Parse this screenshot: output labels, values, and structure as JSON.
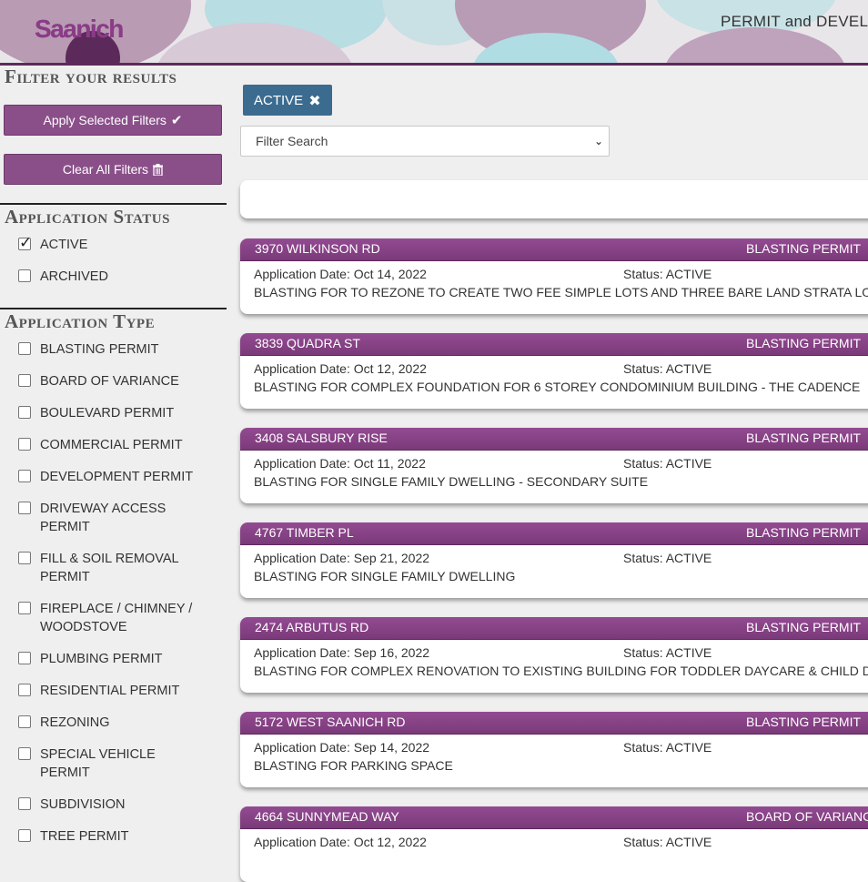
{
  "header": {
    "logo_text": "Saanich",
    "title": "PERMIT and DEVEL"
  },
  "sidebar": {
    "filter_title": "Filter your results",
    "apply_button": "Apply Selected Filters",
    "clear_button": "Clear All Filters",
    "status_heading": "Application Status",
    "status_options": [
      {
        "label": "ACTIVE",
        "checked": true
      },
      {
        "label": "ARCHIVED",
        "checked": false
      }
    ],
    "type_heading": "Application Type",
    "type_options": [
      {
        "label": "BLASTING PERMIT"
      },
      {
        "label": "BOARD OF VARIANCE"
      },
      {
        "label": "BOULEVARD PERMIT"
      },
      {
        "label": "COMMERCIAL PERMIT"
      },
      {
        "label": "DEVELOPMENT PERMIT"
      },
      {
        "label": "DRIVEWAY ACCESS\nPERMIT"
      },
      {
        "label": "FILL & SOIL REMOVAL\nPERMIT"
      },
      {
        "label": "FIREPLACE / CHIMNEY /\nWOODSTOVE"
      },
      {
        "label": "PLUMBING PERMIT"
      },
      {
        "label": "RESIDENTIAL PERMIT"
      },
      {
        "label": "REZONING"
      },
      {
        "label": "SPECIAL VEHICLE\nPERMIT"
      },
      {
        "label": "SUBDIVISION"
      },
      {
        "label": "TREE PERMIT"
      }
    ]
  },
  "main": {
    "active_chip": "ACTIVE",
    "filter_search_placeholder": "Filter Search",
    "results": [
      {
        "address": "3970 WILKINSON RD",
        "type": "BLASTING PERMIT",
        "date": "Application Date: Oct 14, 2022",
        "status": "Status: ACTIVE",
        "description": "BLASTING FOR TO REZONE TO CREATE TWO FEE SIMPLE LOTS AND THREE BARE LAND STRATA LO"
      },
      {
        "address": "3839 QUADRA ST",
        "type": "BLASTING PERMIT",
        "date": "Application Date: Oct 12, 2022",
        "status": "Status: ACTIVE",
        "description": "BLASTING FOR COMPLEX FOUNDATION FOR 6 STOREY CONDOMINIUM BUILDING - THE CADENCE"
      },
      {
        "address": "3408 SALSBURY RISE",
        "type": "BLASTING PERMIT",
        "date": "Application Date: Oct 11, 2022",
        "status": "Status: ACTIVE",
        "description": "BLASTING FOR SINGLE FAMILY DWELLING - SECONDARY SUITE"
      },
      {
        "address": "4767 TIMBER PL",
        "type": "BLASTING PERMIT",
        "date": "Application Date: Sep 21, 2022",
        "status": "Status: ACTIVE",
        "description": "BLASTING FOR SINGLE FAMILY DWELLING"
      },
      {
        "address": "2474 ARBUTUS RD",
        "type": "BLASTING PERMIT",
        "date": "Application Date: Sep 16, 2022",
        "status": "Status: ACTIVE",
        "description": "BLASTING FOR COMPLEX RENOVATION TO EXISTING BUILDING FOR TODDLER DAYCARE & CHILD D"
      },
      {
        "address": "5172 WEST SAANICH RD",
        "type": "BLASTING PERMIT",
        "date": "Application Date: Sep 14, 2022",
        "status": "Status: ACTIVE",
        "description": "BLASTING FOR PARKING SPACE"
      },
      {
        "address": "4664 SUNNYMEAD WAY",
        "type": "BOARD OF VARIANC",
        "date": "Application Date: Oct 12, 2022",
        "status": "Status: ACTIVE",
        "description": ""
      }
    ]
  },
  "colors": {
    "brand_purple": "#8a4f89",
    "card_header": "#934b92",
    "chip_blue": "#3b6b8f",
    "header_rule": "#5c2a5a"
  }
}
